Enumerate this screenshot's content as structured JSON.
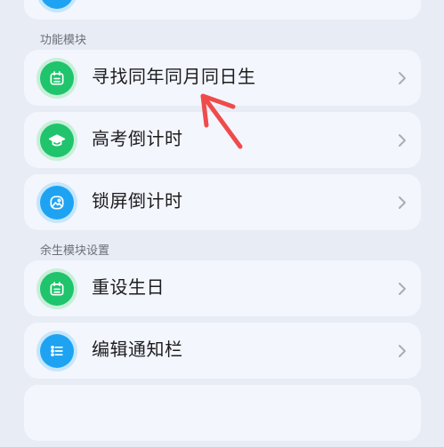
{
  "top_partial_item": {
    "icon": "partial-blue-icon",
    "color": "#1ea3f3",
    "halo": "#c6e6fb"
  },
  "sections": [
    {
      "title": "功能模块",
      "items": [
        {
          "label": "寻找同年同月同日生",
          "icon": "calendar-icon",
          "color": "#1fc46c",
          "halo": "#c8efd9"
        },
        {
          "label": "高考倒计时",
          "icon": "graduation-cap-icon",
          "color": "#1fc46c",
          "halo": "#c8efd9"
        },
        {
          "label": "锁屏倒计时",
          "icon": "image-icon",
          "color": "#1ea3f3",
          "halo": "#c6e6fb"
        }
      ]
    },
    {
      "title": "余生模块设置",
      "items": [
        {
          "label": "重设生日",
          "icon": "calendar-icon",
          "color": "#1fc46c",
          "halo": "#c8efd9"
        },
        {
          "label": "编辑通知栏",
          "icon": "list-icon",
          "color": "#1ea3f3",
          "halo": "#c6e6fb"
        }
      ]
    }
  ],
  "annotation": {
    "arrow_color": "#ef4b4b"
  },
  "theme": {
    "background": "#e7ecf5",
    "card": "#f3f6fd",
    "text": "#1d1d1f",
    "muted": "#6b6f78",
    "chevron": "#a9adb5"
  }
}
